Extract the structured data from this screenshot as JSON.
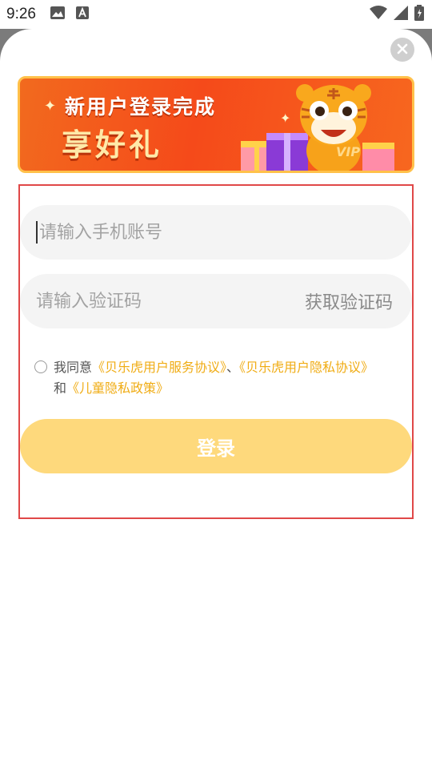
{
  "status_bar": {
    "time": "9:26",
    "icons_left": [
      "image-icon",
      "text-a-icon"
    ],
    "icons_right": [
      "wifi-icon",
      "signal-icon",
      "battery-charging-icon"
    ]
  },
  "dialog": {
    "close_icon": "close-icon"
  },
  "banner": {
    "line1": "新用户登录完成",
    "line2": "享好礼",
    "badge": "VIP",
    "colors": {
      "background": "#f54a1a",
      "border": "#ffc14a",
      "headline": "#ffe9a8"
    }
  },
  "form": {
    "phone_placeholder": "请输入手机账号",
    "phone_value": "",
    "code_placeholder": "请输入验证码",
    "code_value": "",
    "get_code_label": "获取验证码"
  },
  "agreement": {
    "checked": false,
    "prefix": "我同意",
    "link1": "《贝乐虎用户服务协议》",
    "sep": "、",
    "link2": "《贝乐虎用户隐私协议》",
    "and": "和",
    "link3": "《儿童隐私政策》",
    "link_color": "#f0ac14"
  },
  "login_button": {
    "label": "登录",
    "color": "#fed97c"
  }
}
